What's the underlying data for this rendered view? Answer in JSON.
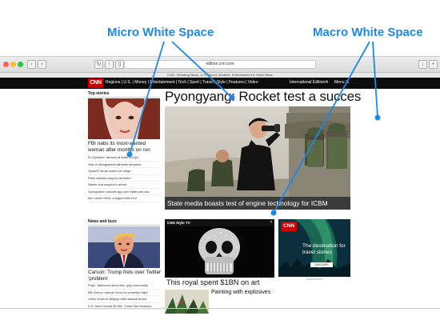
{
  "annotations": {
    "micro": "Micro White Space",
    "macro": "Macro White Space",
    "arrow_color": "#1e88e5"
  },
  "browser": {
    "url": "edition.cnn.com",
    "tab_title": "CNN - Breaking News, U.S., World, Weather, Entertainment & Video News"
  },
  "nav": {
    "logo": "CNN",
    "links": "Regions  |  U.S.  |  Money  |  Entertainment  |  Tech  |  Sport  |  Travel  |  Style  |  Features  |  Video",
    "edition": "International Edition +",
    "menu": "Menu",
    "brand_red": "#cc0000"
  },
  "top_stories": {
    "header": "Top stories",
    "lead": "FBI nabs its most-wanted woman after months on run",
    "items": [
      "Ex-Speaker 'abused at least 4 boys'",
      "War on Bangladesh atheists declared",
      "SpaceX lands rocket on barge",
      "Paris attacks suspect arrested",
      "Watch ona suspect's arrest",
      "Springsteen cancels gig over bathroom law",
      "Bin Laden SEAL charged with DUI"
    ]
  },
  "main": {
    "headline": "Pyongyang: Rocket test a succes",
    "caption": "State media boasts test of engine technology for ICBM"
  },
  "news_buzz": {
    "header": "News and buzz",
    "lead": "Carson: Trump frets over Twitter 'problem'",
    "items": [
      "Pope, Melcome divorcees, gay community",
      "Bill Clinton 'almost' sorry for protester fight",
      "Video leads to Beijing hotel assault arrest",
      "U.S. fines Honda $1.5M, China Sea tensions"
    ]
  },
  "style_tv": {
    "label": "CNN Style TV",
    "caption": "This royal spent $1BN on art",
    "secondary": "Painting with explosives"
  },
  "ad": {
    "logo": "CNN",
    "text": "The destination for travel stories",
    "button": "DISCOVER",
    "label": "Advertisement"
  }
}
